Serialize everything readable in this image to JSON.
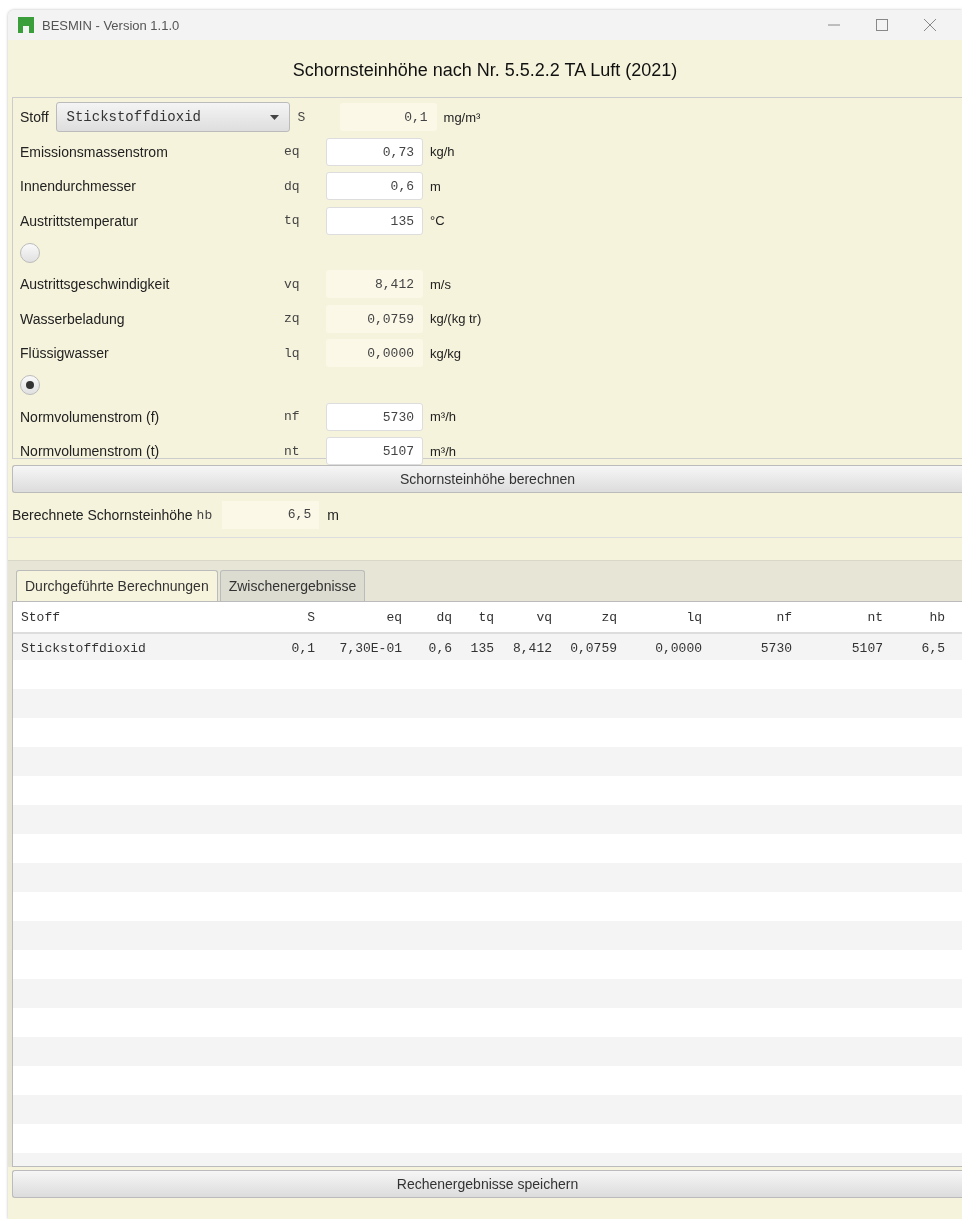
{
  "window": {
    "title": "BESMIN - Version 1.1.0"
  },
  "heading": "Schornsteinhöhe nach Nr. 5.5.2.2 TA Luft (2021)",
  "form": {
    "rows": [
      {
        "kind": "select",
        "label": "Stoff",
        "value": "Stickstoffdioxid",
        "code": "S",
        "field": "0,1",
        "editable": false,
        "unit": "mg/m³"
      },
      {
        "kind": "field",
        "label": "Emissionsmassenstrom",
        "code": "eq",
        "field": "0,73",
        "editable": true,
        "unit": "kg/h"
      },
      {
        "kind": "field",
        "label": "Innendurchmesser",
        "code": "dq",
        "field": "0,6",
        "editable": true,
        "unit": "m"
      },
      {
        "kind": "field",
        "label": "Austrittstemperatur",
        "code": "tq",
        "field": "135",
        "editable": true,
        "unit": "°C"
      },
      {
        "kind": "radio",
        "selected": false
      },
      {
        "kind": "field",
        "label": "Austrittsgeschwindigkeit",
        "code": "vq",
        "field": "8,412",
        "editable": false,
        "unit": "m/s"
      },
      {
        "kind": "field",
        "label": "Wasserbeladung",
        "code": "zq",
        "field": "0,0759",
        "editable": false,
        "unit": "kg/(kg tr)"
      },
      {
        "kind": "field",
        "label": "Flüssigwasser",
        "code": "lq",
        "field": "0,0000",
        "editable": false,
        "unit": "kg/kg"
      },
      {
        "kind": "radio",
        "selected": true
      },
      {
        "kind": "field",
        "label": "Normvolumenstrom (f)",
        "code": "nf",
        "field": "5730",
        "editable": true,
        "unit": "m³/h"
      },
      {
        "kind": "field",
        "label": "Normvolumenstrom (t)",
        "code": "nt",
        "field": "5107",
        "editable": true,
        "unit": "m³/h"
      }
    ]
  },
  "calculate_button": "Schornsteinhöhe berechnen",
  "result": {
    "label": "Berechnete Schornsteinhöhe",
    "code": "hb",
    "value": "6,5",
    "unit": "m"
  },
  "tabs": [
    {
      "label": "Durchgeführte Berechnungen",
      "selected": true
    },
    {
      "label": "Zwischenergebnisse",
      "selected": false
    }
  ],
  "table": {
    "columns": [
      "Stoff",
      "S",
      "eq",
      "dq",
      "tq",
      "vq",
      "zq",
      "lq",
      "nf",
      "nt",
      "hb"
    ],
    "rows": [
      [
        "Stickstoffdioxid",
        "0,1",
        "7,30E-01",
        "0,6",
        "135",
        "8,412",
        "0,0759",
        "0,0000",
        "5730",
        "5107",
        "6,5"
      ]
    ]
  },
  "save_button": "Rechenergebnisse speichern"
}
